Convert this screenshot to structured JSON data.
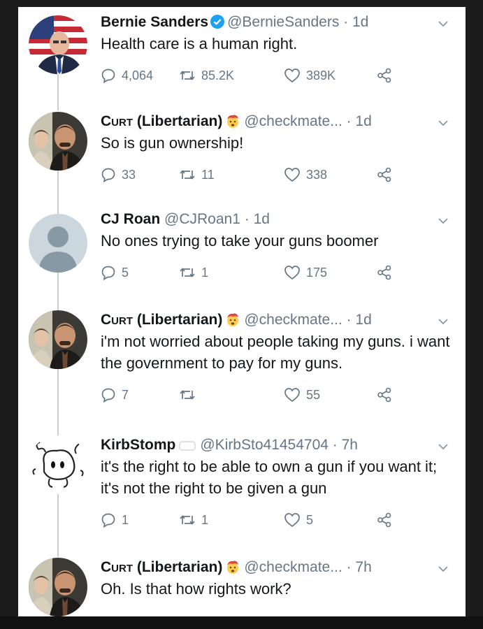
{
  "tweets": [
    {
      "name": "Bernie Sanders",
      "handle": "@BernieSanders",
      "time": "· 1d",
      "text": "Health care is a human right.",
      "replies": "4,064",
      "retweets": "85.2K",
      "likes": "389K",
      "verified": true,
      "avatar": "bernie-avatar"
    },
    {
      "name_sc": "Curt",
      "name_rest": " (Libertarian)",
      "handle": "@checkmate...",
      "time": "· 1d",
      "text": "So is gun ownership!",
      "replies": "33",
      "retweets": "11",
      "likes": "338",
      "emoji": "exploding-head-icon",
      "avatar": "curt-avatar"
    },
    {
      "name": "CJ Roan",
      "handle": "@CJRoan1",
      "time": "· 1d",
      "text": "No ones trying to take your guns boomer",
      "replies": "5",
      "retweets": "1",
      "likes": "175",
      "avatar": "default-avatar"
    },
    {
      "name_sc": "Curt",
      "name_rest": " (Libertarian)",
      "handle": "@checkmate...",
      "time": "· 1d",
      "text": "i'm not worried about people taking my guns. i want the government to pay for my guns.",
      "replies": "7",
      "retweets": "",
      "likes": "55",
      "emoji": "exploding-head-icon",
      "avatar": "curt-avatar"
    },
    {
      "name": "KirbStomp",
      "handle": "@KirbSto41454704",
      "time": "· 7h",
      "text": "it's the right to be able to own a gun if you want it; it's not the right to be given a gun",
      "replies": "1",
      "retweets": "1",
      "likes": "5",
      "avatar": "cartoon-avatar"
    },
    {
      "name_sc": "Curt",
      "name_rest": " (Libertarian)",
      "handle": "@checkmate...",
      "time": "· 7h",
      "text": "Oh. Is that how rights work?",
      "emoji": "exploding-head-icon",
      "avatar": "curt-avatar"
    }
  ],
  "colors": {
    "verified": "#1da1f2",
    "text": "#14171a",
    "secondary": "#657786",
    "thread_line": "#c4cfd6"
  }
}
